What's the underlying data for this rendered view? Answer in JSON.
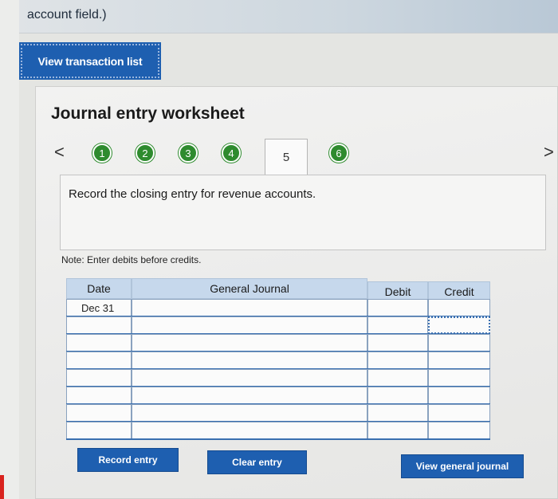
{
  "header": {
    "text": "account field.)"
  },
  "buttons": {
    "view_transactions": "View transaction list",
    "record_entry": "Record entry",
    "clear_entry": "Clear entry",
    "view_journal": "View general journal"
  },
  "worksheet": {
    "title": "Journal entry worksheet",
    "nav_prev": "<",
    "nav_next": ">",
    "steps": [
      "1",
      "2",
      "3",
      "4",
      "5",
      "6"
    ],
    "active_step": "5",
    "instruction": "Record the closing entry for revenue accounts.",
    "note": "Note: Enter debits before credits."
  },
  "table": {
    "headers": {
      "date": "Date",
      "journal": "General Journal",
      "debit": "Debit",
      "credit": "Credit"
    },
    "rows": [
      {
        "date": "Dec 31",
        "account": "",
        "debit": "",
        "credit": ""
      },
      {
        "date": "",
        "account": "",
        "debit": "",
        "credit": ""
      },
      {
        "date": "",
        "account": "",
        "debit": "",
        "credit": ""
      },
      {
        "date": "",
        "account": "",
        "debit": "",
        "credit": ""
      },
      {
        "date": "",
        "account": "",
        "debit": "",
        "credit": ""
      },
      {
        "date": "",
        "account": "",
        "debit": "",
        "credit": ""
      },
      {
        "date": "",
        "account": "",
        "debit": "",
        "credit": ""
      },
      {
        "date": "",
        "account": "",
        "debit": "",
        "credit": ""
      }
    ]
  },
  "colors": {
    "accent": "#1e5fb0",
    "step": "#2e8b2e",
    "header_bg": "#c6d8ec"
  }
}
